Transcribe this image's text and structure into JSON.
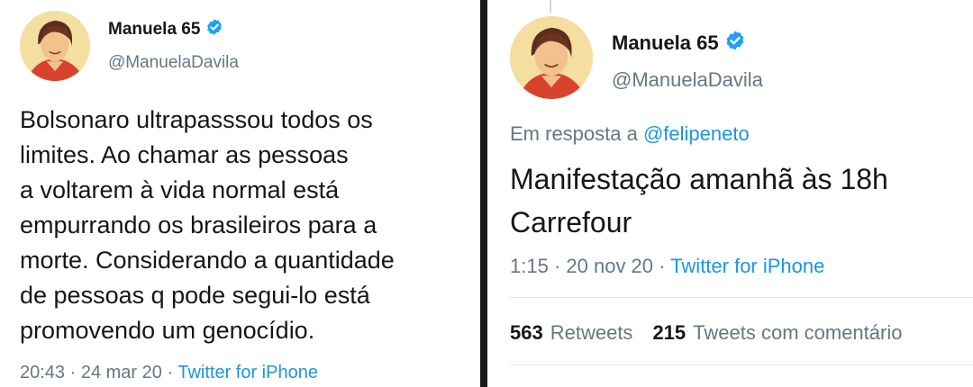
{
  "left_tweet": {
    "display_name": "Manuela 65",
    "handle": "@ManuelaDavila",
    "text_lines": [
      "Bolsonaro ultrapasssou todos os",
      "limites. Ao chamar as pessoas",
      "a voltarem à vida normal está",
      "empurrando os brasileiros para a",
      "morte. Considerando a quantidade",
      "de pessoas q pode segui-lo está",
      "promovendo um genocídio."
    ],
    "time": "20:43",
    "date": "24 mar 20",
    "source": "Twitter for iPhone"
  },
  "right_tweet": {
    "display_name": "Manuela 65",
    "handle": "@ManuelaDavila",
    "reply_prefix": "Em resposta a",
    "reply_mention": "@felipeneto",
    "text_lines": [
      "Manifestação amanhã às 18h",
      "Carrefour"
    ],
    "time": "1:15",
    "date": "20 nov 20",
    "source": "Twitter for iPhone",
    "retweets_count": "563",
    "retweets_label": "Retweets",
    "quotes_count": "215",
    "quotes_label": "Tweets com comentário"
  },
  "separator": " · ",
  "colors": {
    "text": "#14171a",
    "secondary": "#657786",
    "link": "#1b95e0",
    "verified": "#1da1f2",
    "background": "#ffffff"
  },
  "icons": {
    "verified": "verified-badge-icon",
    "avatar": "profile-avatar"
  }
}
